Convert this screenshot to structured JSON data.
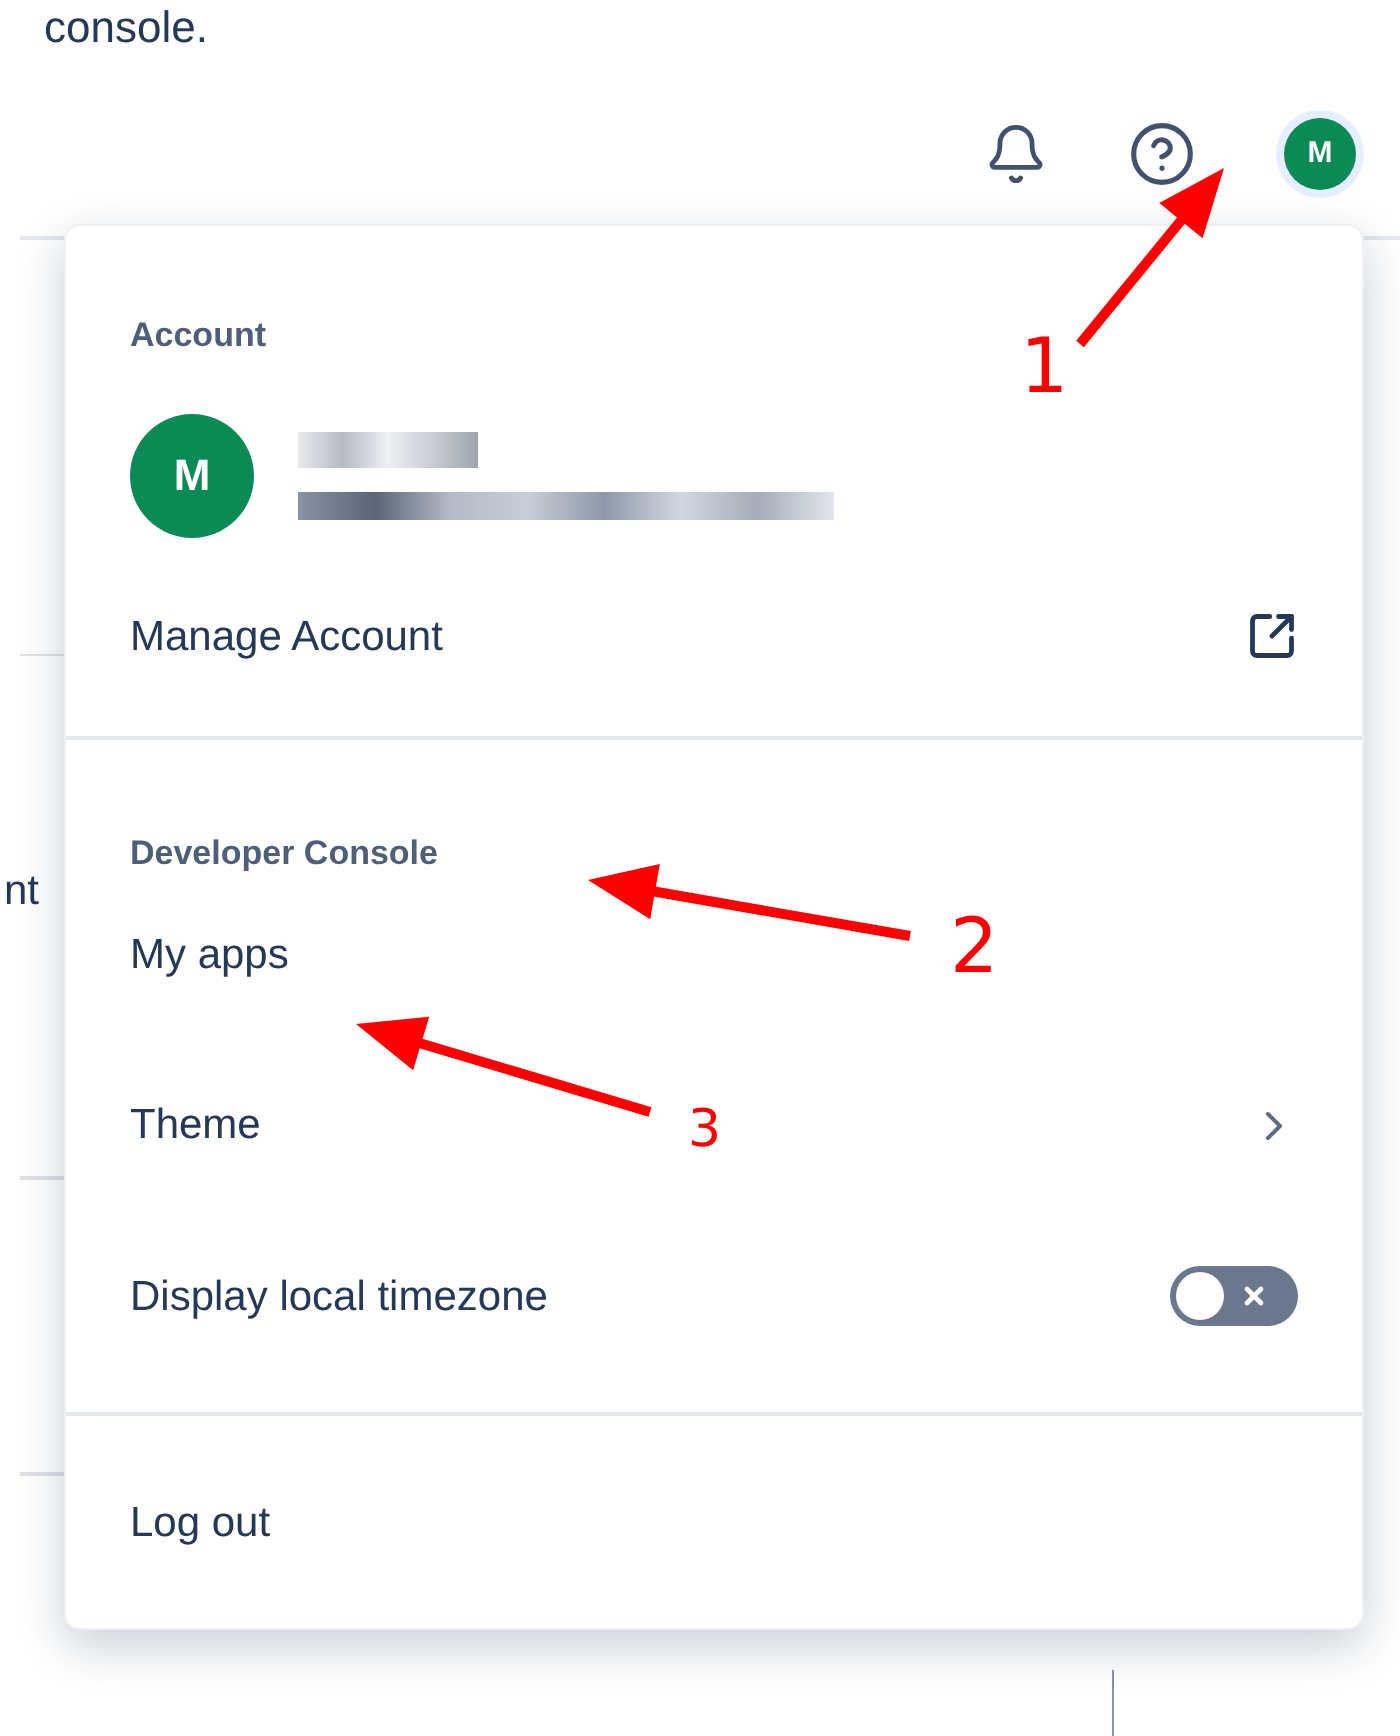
{
  "page": {
    "cut_text_top": "console.",
    "cut_text_left": "nt"
  },
  "top_bar": {
    "avatar_letter": "M"
  },
  "menu": {
    "sections": [
      {
        "heading": "Account",
        "profile": {
          "avatar_letter": "M"
        },
        "items": [
          {
            "kind": "external",
            "label": "Manage Account"
          }
        ]
      },
      {
        "heading": "Developer Console",
        "items": [
          {
            "kind": "plain",
            "label": "My apps"
          },
          {
            "kind": "submenu",
            "label": "Theme"
          },
          {
            "kind": "toggle",
            "label": "Display local timezone",
            "on": false
          }
        ]
      },
      {
        "items": [
          {
            "kind": "plain",
            "label": "Log out"
          }
        ]
      }
    ]
  },
  "annotations": [
    {
      "label": "1"
    },
    {
      "label": "2"
    },
    {
      "label": "3"
    }
  ]
}
